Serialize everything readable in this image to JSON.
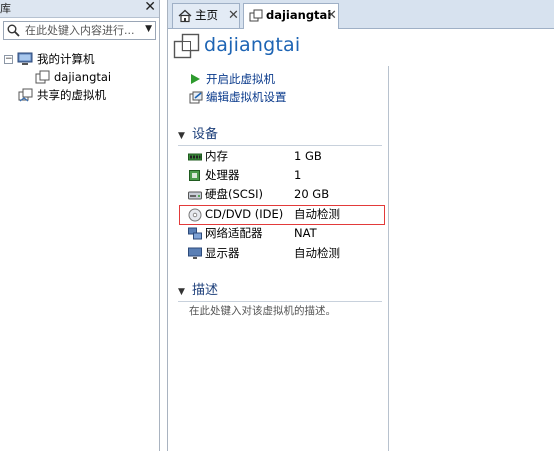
{
  "library": {
    "title": "库",
    "close": "✕",
    "search_placeholder": "在此处键入内容进行...",
    "tree": [
      {
        "label": "我的计算机",
        "toggle": "−",
        "icon": "computer-icon"
      },
      {
        "label": "dajiangtai",
        "icon": "vm-icon"
      },
      {
        "label": "共享的虚拟机",
        "icon": "shared-vm-icon"
      }
    ]
  },
  "tabs": [
    {
      "label": "主页",
      "icon": "home-icon",
      "close": "✕"
    },
    {
      "label": "dajiangtai",
      "icon": "vm-icon",
      "close": "✕"
    }
  ],
  "vm": {
    "title": "dajiangtai",
    "actions": [
      {
        "label": "开启此虚拟机",
        "icon": "play-icon"
      },
      {
        "label": "编辑虚拟机设置",
        "icon": "settings-icon"
      }
    ],
    "devices_header": "设备",
    "devices": [
      {
        "name": "内存",
        "value": "1 GB",
        "icon": "memory-icon"
      },
      {
        "name": "处理器",
        "value": "1",
        "icon": "cpu-icon"
      },
      {
        "name": "硬盘(SCSI)",
        "value": "20 GB",
        "icon": "harddisk-icon"
      },
      {
        "name": "CD/DVD (IDE)",
        "value": "自动检测",
        "icon": "cd-dvd-icon"
      },
      {
        "name": "网络适配器",
        "value": "NAT",
        "icon": "network-icon"
      },
      {
        "name": "显示器",
        "value": "自动检测",
        "icon": "display-icon"
      }
    ],
    "description_header": "描述",
    "description_placeholder": "在此处键入对该虚拟机的描述。"
  },
  "colors": {
    "accent_title": "#1d64b4",
    "highlight": "#e23a3a",
    "tab_strip": "#d7e2ef"
  }
}
